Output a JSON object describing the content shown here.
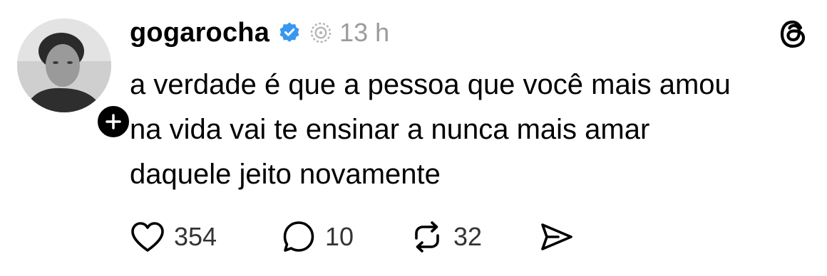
{
  "post": {
    "username": "gogarocha",
    "time": "13 h",
    "text_lines": [
      "a verdade é que a pessoa que você mais amou",
      "na vida vai te ensinar a nunca mais amar",
      "daquele jeito novamente"
    ],
    "icons": {
      "verified": "verified-badge-icon",
      "meta": "threads-meta-icon",
      "logo": "threads-logo-icon",
      "follow": "plus-icon"
    },
    "colors": {
      "verified": "#3897f0",
      "time": "#9b9b9b",
      "follow_badge": "#000000"
    }
  },
  "actions": {
    "likes": "354",
    "replies": "10",
    "reposts": "32"
  }
}
